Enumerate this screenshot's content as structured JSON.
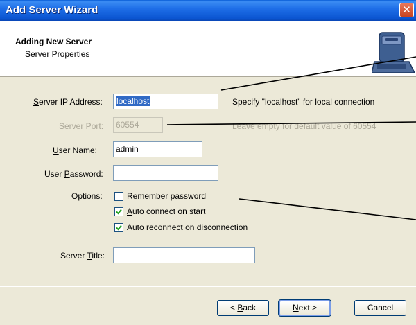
{
  "window": {
    "title": "Add Server Wizard",
    "close_glyph": "✕"
  },
  "header": {
    "title": "Adding New Server",
    "subtitle": "Server Properties",
    "icon": "server-computer-icon"
  },
  "form": {
    "ip": {
      "label_pre": "",
      "label_u": "S",
      "label_post": "erver IP Address:",
      "value": "localhost",
      "hint": "Specify \"localhost\" for local connection"
    },
    "port": {
      "label_pre": "Server P",
      "label_u": "o",
      "label_post": "rt:",
      "value": "60554",
      "hint": "Leave empty for default value of 60554",
      "disabled": true
    },
    "user": {
      "label_pre": "",
      "label_u": "U",
      "label_post": "ser Name:",
      "value": "admin"
    },
    "password": {
      "label_pre": "User ",
      "label_u": "P",
      "label_post": "assword:",
      "value": ""
    },
    "options": {
      "label": "Options:",
      "items": [
        {
          "pre": "",
          "u": "R",
          "post": "emember password",
          "checked": false
        },
        {
          "pre": "",
          "u": "A",
          "post": "uto connect on start",
          "checked": true
        },
        {
          "pre": "Auto ",
          "u": "r",
          "post": "econnect on disconnection",
          "checked": true
        }
      ]
    },
    "title": {
      "label_pre": "Server ",
      "label_u": "T",
      "label_post": "itle:",
      "value": ""
    }
  },
  "buttons": {
    "back": {
      "pre": "< ",
      "u": "B",
      "post": "ack"
    },
    "next": {
      "pre": "",
      "u": "N",
      "post": "ext >"
    },
    "cancel": {
      "label": "Cancel"
    }
  },
  "colors": {
    "titlebar": "#0b55d1",
    "dialog_bg": "#ece9d8",
    "selection": "#316ac5",
    "close": "#c9431f"
  }
}
